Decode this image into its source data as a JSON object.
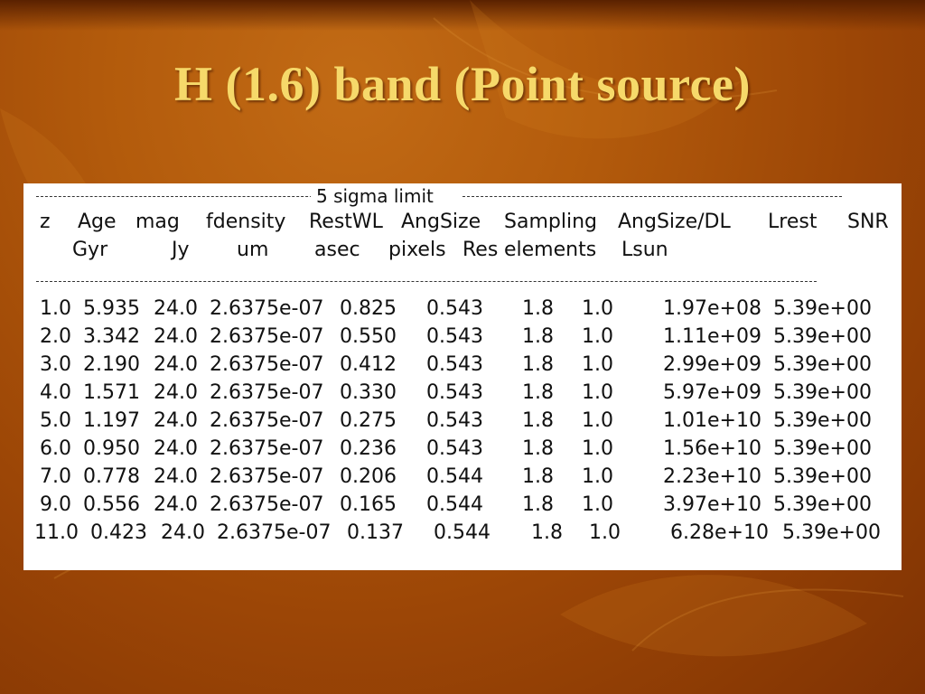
{
  "slide": {
    "title": "H (1.6) band  (Point source)"
  },
  "table": {
    "banner": "5 sigma limit",
    "header_row1": [
      "z",
      "Age",
      "mag",
      "fdensity",
      "RestWL",
      "AngSize",
      "Sampling",
      "AngSize/DL",
      "Lrest",
      "SNR"
    ],
    "header_row2": [
      "Gyr",
      "Jy",
      "um",
      "asec",
      "pixels",
      "Res",
      "elements",
      "Lsun"
    ],
    "rows": [
      [
        "1.0",
        "5.935",
        "24.0",
        "2.6375e-07",
        "0.825",
        "0.543",
        "1.8",
        "1.0",
        "1.97e+08",
        "5.39e+00"
      ],
      [
        "2.0",
        "3.342",
        "24.0",
        "2.6375e-07",
        "0.550",
        "0.543",
        "1.8",
        "1.0",
        "1.11e+09",
        "5.39e+00"
      ],
      [
        "3.0",
        "2.190",
        "24.0",
        "2.6375e-07",
        "0.412",
        "0.543",
        "1.8",
        "1.0",
        "2.99e+09",
        "5.39e+00"
      ],
      [
        "4.0",
        "1.571",
        "24.0",
        "2.6375e-07",
        "0.330",
        "0.543",
        "1.8",
        "1.0",
        "5.97e+09",
        "5.39e+00"
      ],
      [
        "5.0",
        "1.197",
        "24.0",
        "2.6375e-07",
        "0.275",
        "0.543",
        "1.8",
        "1.0",
        "1.01e+10",
        "5.39e+00"
      ],
      [
        "6.0",
        "0.950",
        "24.0",
        "2.6375e-07",
        "0.236",
        "0.543",
        "1.8",
        "1.0",
        "1.56e+10",
        "5.39e+00"
      ],
      [
        "7.0",
        "0.778",
        "24.0",
        "2.6375e-07",
        "0.206",
        "0.544",
        "1.8",
        "1.0",
        "2.23e+10",
        "5.39e+00"
      ],
      [
        "9.0",
        "0.556",
        "24.0",
        "2.6375e-07",
        "0.165",
        "0.544",
        "1.8",
        "1.0",
        "3.97e+10",
        "5.39e+00"
      ],
      [
        "11.0",
        "0.423",
        "24.0",
        "2.6375e-07",
        "0.137",
        "0.544",
        "1.8",
        "1.0",
        "6.28e+10",
        "5.39e+00"
      ]
    ]
  },
  "colors": {
    "background": "#b35b0c",
    "title": "#f6d96a",
    "panel": "#ffffff",
    "text": "#111111"
  }
}
